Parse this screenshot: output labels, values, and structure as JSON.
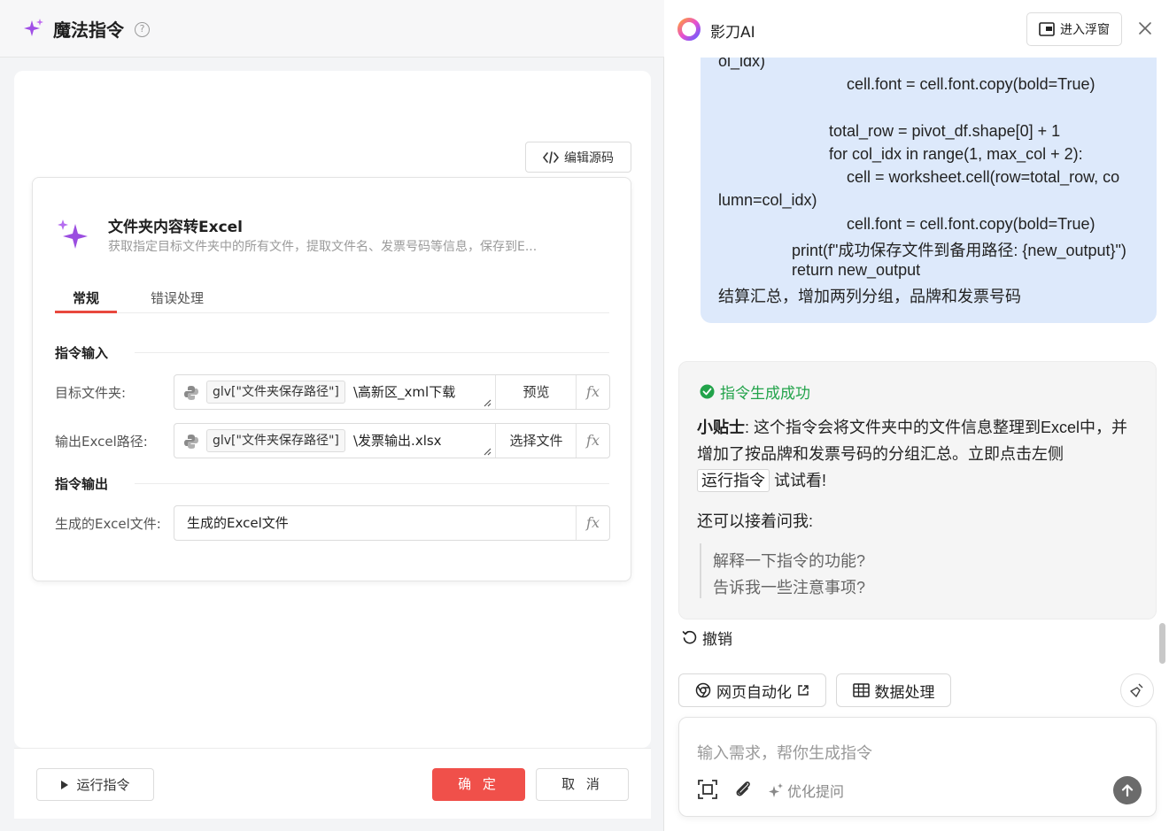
{
  "left": {
    "header": {
      "title": "魔法指令",
      "help_icon": "question-circle-icon"
    },
    "edit_source_label": "编辑源码",
    "command": {
      "title": "文件夹内容转Excel",
      "description": "获取指定目标文件夹中的所有文件，提取文件名、发票号码等信息，保存到E..."
    },
    "tabs": [
      {
        "label": "常规",
        "active": true
      },
      {
        "label": "错误处理",
        "active": false
      }
    ],
    "input_section": "指令输入",
    "output_section": "指令输出",
    "fields": {
      "target_folder": {
        "label": "目标文件夹:",
        "var_chip": "glv[\"文件夹保存路径\"]",
        "suffix": "\\高新区_xml下载",
        "action": "预览"
      },
      "output_path": {
        "label": "输出Excel路径:",
        "var_chip": "glv[\"文件夹保存路径\"]",
        "suffix": "\\发票输出.xlsx",
        "action": "选择文件"
      },
      "output_file": {
        "label": "生成的Excel文件:",
        "value": "生成的Excel文件"
      }
    },
    "fx_label": "fx",
    "footer": {
      "run_label": "运行指令",
      "ok_label": "确 定",
      "cancel_label": "取 消"
    }
  },
  "right": {
    "header": {
      "name": "影刀AI",
      "float_label": "进入浮窗"
    },
    "code_lines": [
      "ol_idx)",
      "cell.font = cell.font.copy(bold=True)",
      "total_row = pivot_df.shape[0] + 1",
      "for col_idx in range(1, max_col + 2):",
      "cell = worksheet.cell(row=total_row, co",
      "lumn=col_idx)",
      "cell.font = cell.font.copy(bold=True)",
      "print(f\"成功保存文件到备用路径: {new_output}\")",
      "return new_output",
      "结算汇总，增加两列分组，品牌和发票号码"
    ],
    "result": {
      "success_label": "指令生成成功",
      "tip_label": "小贴士",
      "tip_text_1": ": 这个指令会将文件夹中的文件信息整理到Excel中，并增加了按品牌和发票号码的分组汇总。立即点击左侧",
      "tip_chip": "运行指令",
      "tip_text_2": "试试看!",
      "ask_more": "还可以接着问我:",
      "suggestions": [
        "解释一下指令的功能?",
        "告诉我一些注意事项?"
      ]
    },
    "undo_label": "撤销",
    "quick_actions": [
      {
        "label": "网页自动化",
        "icon": "chrome-icon"
      },
      {
        "label": "数据处理",
        "icon": "table-icon"
      }
    ],
    "input": {
      "placeholder": "输入需求，帮你生成指令",
      "optimize_label": "优化提问"
    }
  },
  "colors": {
    "accent_red": "#f0504a",
    "success_green": "#22a34a",
    "bubble_blue": "#dde9fb",
    "sparkle_purple": "#9b4de0"
  }
}
